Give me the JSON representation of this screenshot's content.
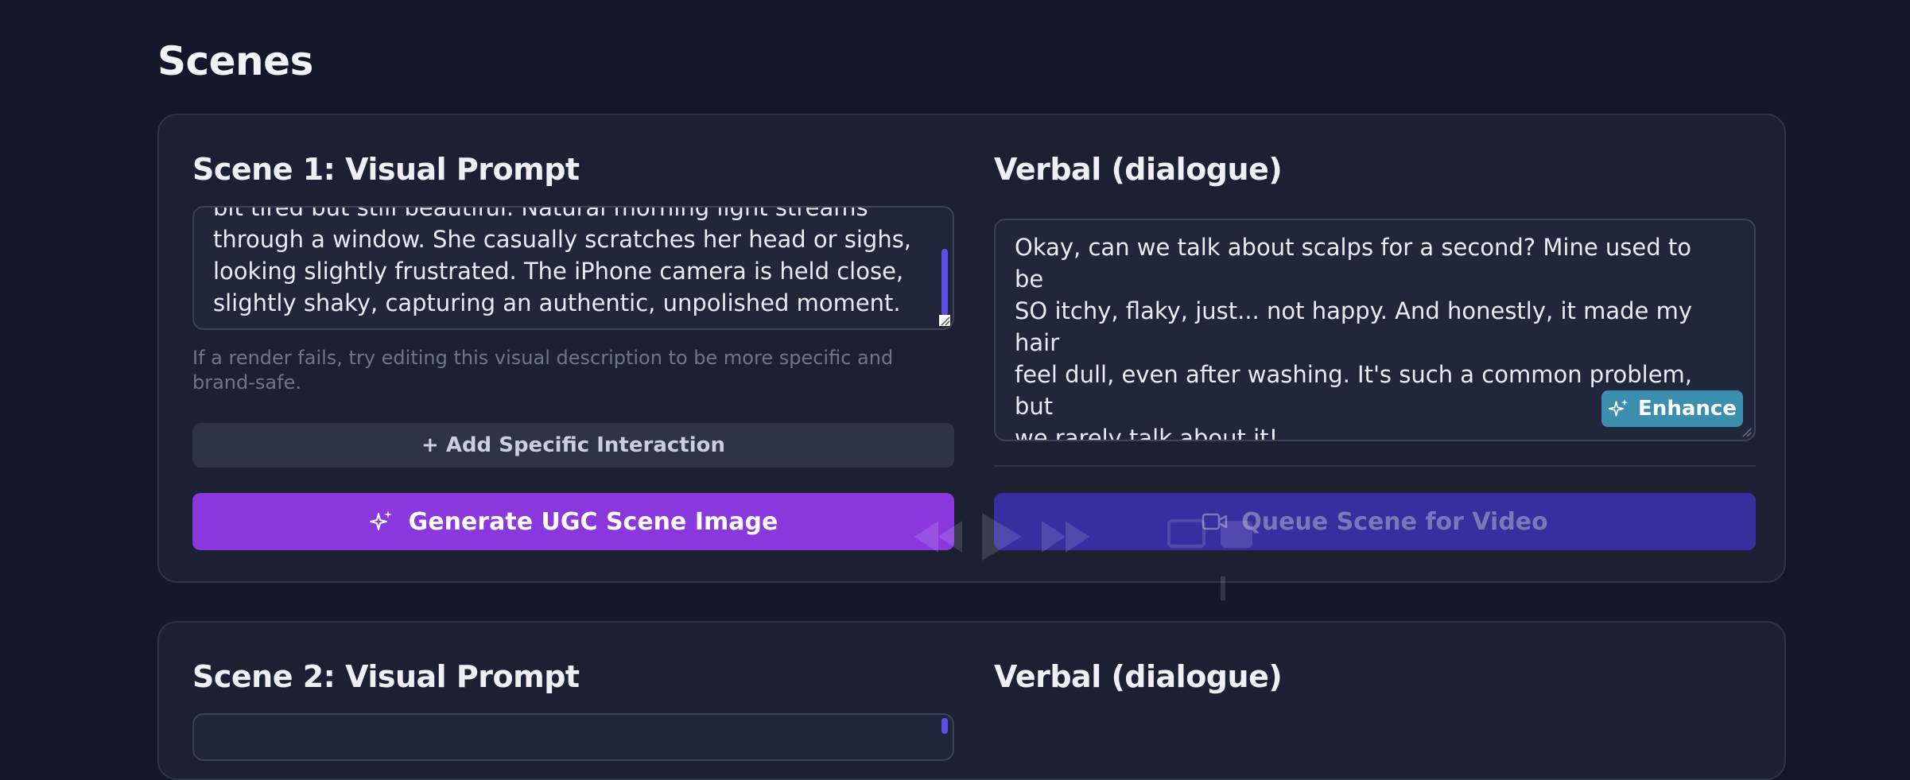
{
  "page": {
    "title": "Scenes"
  },
  "scenes": [
    {
      "visual_heading": "Scene 1: Visual Prompt",
      "visual_prompt_visible": "bit tired but still beautiful. Natural morning light streams through a window. She casually scratches her head or sighs, looking slightly frustrated. The iPhone camera is held close, slightly shaky, capturing an authentic, unpolished moment.",
      "visual_lines": [
        "bit tired but still beautiful. Natural morning light streams",
        "through a window. She casually scratches her head or sighs,",
        "looking slightly frustrated. The iPhone camera is held close,",
        "slightly shaky, capturing an authentic, unpolished moment."
      ],
      "hint": "If a render fails, try editing this visual description to be more specific and brand-safe.",
      "add_interaction_label": "+ Add Specific Interaction",
      "generate_label": "Generate UGC Scene Image",
      "verbal_heading": "Verbal (dialogue)",
      "dialogue_lines": [
        "Okay, can we talk about scalps for a second? Mine used to be",
        "SO itchy, flaky, just... not happy. And honestly, it made my hair",
        "feel dull, even after washing. It's such a common problem, but",
        "we rarely talk about it!"
      ],
      "enhance_label": "Enhance",
      "queue_label": "Queue Scene for Video"
    },
    {
      "visual_heading": "Scene 2: Visual Prompt",
      "verbal_heading": "Verbal (dialogue)"
    }
  ],
  "colors": {
    "background": "#121729",
    "card": "#1b2133",
    "generate_button": "#8a37de",
    "queue_button": "#352fa0",
    "enhance_button": "#3b8eae",
    "scrollbar": "#5b4ee6"
  },
  "icons": {
    "generate": "sparkles-icon",
    "enhance": "sparkles-icon",
    "queue": "video-camera-icon"
  }
}
